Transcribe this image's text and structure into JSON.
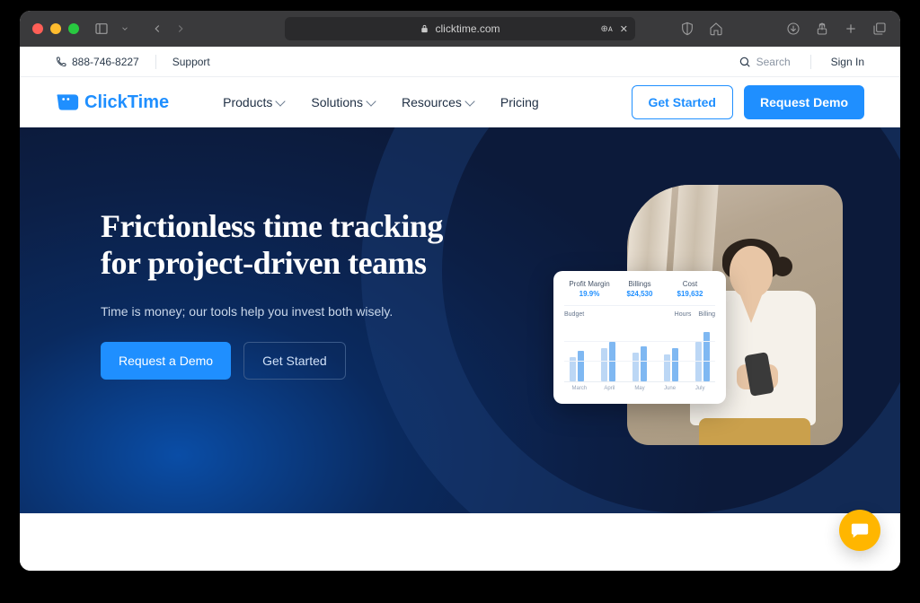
{
  "browser": {
    "url": "clicktime.com"
  },
  "topbar": {
    "phone": "888-746-8227",
    "support": "Support",
    "search_placeholder": "Search",
    "signin": "Sign In"
  },
  "logo": {
    "text": "ClickTime"
  },
  "nav": {
    "items": [
      {
        "label": "Products",
        "dropdown": true
      },
      {
        "label": "Solutions",
        "dropdown": true
      },
      {
        "label": "Resources",
        "dropdown": true
      },
      {
        "label": "Pricing",
        "dropdown": false
      }
    ],
    "get_started": "Get Started",
    "request_demo": "Request Demo"
  },
  "hero": {
    "title": "Frictionless time tracking for project-driven teams",
    "subtitle": "Time is money; our tools help you invest both wisely.",
    "cta_primary": "Request a Demo",
    "cta_secondary": "Get Started"
  },
  "card": {
    "metrics": [
      {
        "label": "Profit Margin",
        "value": "19.9%"
      },
      {
        "label": "Billings",
        "value": "$24,530"
      },
      {
        "label": "Cost",
        "value": "$19,632"
      }
    ],
    "section_label": "Budget",
    "legend_a": "Hours",
    "legend_b": "Billing"
  },
  "chart_data": {
    "type": "bar",
    "categories": [
      "March",
      "April",
      "May",
      "June",
      "July"
    ],
    "series": [
      {
        "name": "Hours",
        "values": [
          30,
          42,
          36,
          34,
          50
        ]
      },
      {
        "name": "Billing",
        "values": [
          38,
          50,
          44,
          42,
          62
        ]
      }
    ],
    "ylim": [
      0,
      70
    ]
  }
}
